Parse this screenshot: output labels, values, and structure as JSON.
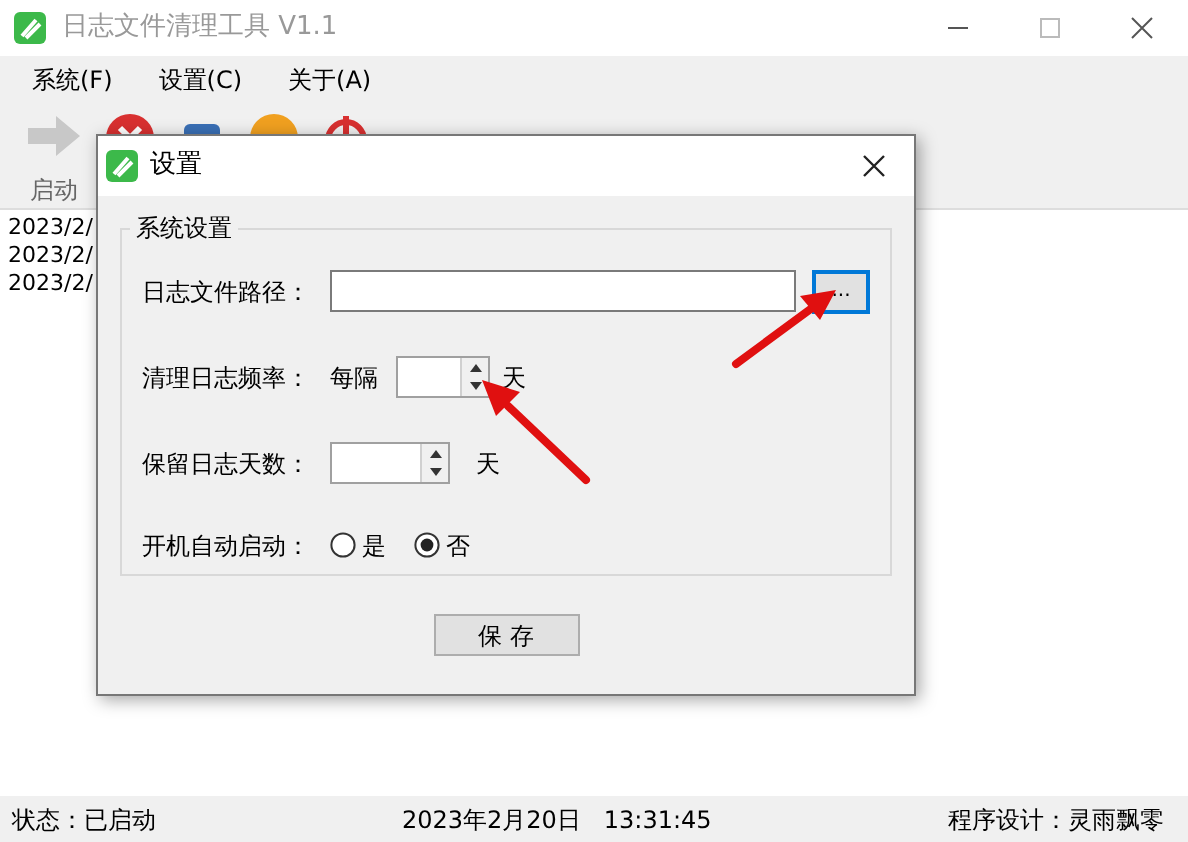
{
  "window": {
    "title": "日志文件清理工具 V1.1"
  },
  "menu": [
    "系统(F)",
    "设置(C)",
    "关于(A)"
  ],
  "toolbar": {
    "start_label": "启动"
  },
  "log_lines": [
    "2023/2/",
    "2023/2/",
    "2023/2/"
  ],
  "status_bar": {
    "status": "状态：已启动",
    "datetime": "2023年2月20日   13:31:45",
    "author": "程序设计：灵雨飘零"
  },
  "dialog": {
    "title": "设置",
    "group_title": "系统设置",
    "path": {
      "label": "日志文件路径：",
      "browse": "..."
    },
    "frequency": {
      "label": "清理日志频率：",
      "prefix": "每隔",
      "unit": "天"
    },
    "retain": {
      "label": "保留日志天数：",
      "unit": "天"
    },
    "autostart": {
      "label": "开机自动启动：",
      "options": [
        {
          "label": "是",
          "selected": false
        },
        {
          "label": "否",
          "selected": true
        }
      ]
    },
    "save_button": "保 存"
  }
}
